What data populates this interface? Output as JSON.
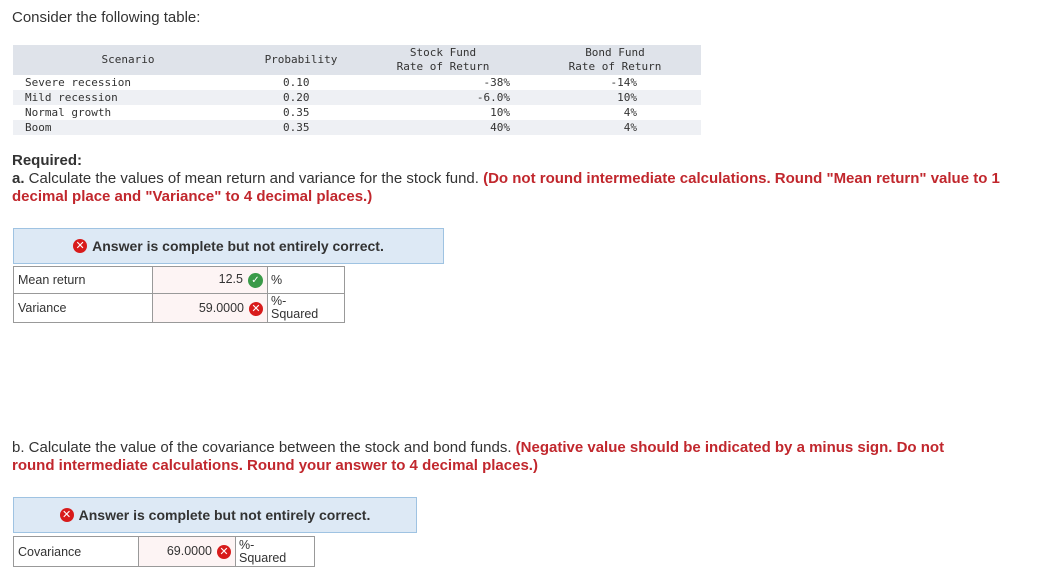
{
  "intro": "Consider the following table:",
  "table": {
    "headers": {
      "scenario": "Scenario",
      "probability": "Probability",
      "stock_line1": "Stock Fund",
      "stock_line2": "Rate of Return",
      "bond_line1": "Bond Fund",
      "bond_line2": "Rate of Return"
    },
    "rows": [
      {
        "scenario": "Severe recession",
        "probability": "0.10",
        "stock": "-38%",
        "bond": "-14%"
      },
      {
        "scenario": "Mild recession",
        "probability": "0.20",
        "stock": "-6.0%",
        "bond": "10%"
      },
      {
        "scenario": "Normal growth",
        "probability": "0.35",
        "stock": "10%",
        "bond": "4%"
      },
      {
        "scenario": "Boom",
        "probability": "0.35",
        "stock": "40%",
        "bond": "4%"
      }
    ]
  },
  "required": "Required:",
  "part_a": {
    "letter": "a.",
    "text": " Calculate the values of mean return and variance for the stock fund. ",
    "instruction": "(Do not round intermediate calculations. Round \"Mean return\" value to 1 decimal place and \"Variance\" to 4 decimal places.)",
    "banner": "Answer is complete but not entirely correct.",
    "answers": [
      {
        "label": "Mean return",
        "value": "12.5",
        "status": "correct",
        "unit_line1": "%",
        "unit_line2": ""
      },
      {
        "label": "Variance",
        "value": "59.0000",
        "status": "incorrect",
        "unit_line1": "%-",
        "unit_line2": "Squared"
      }
    ]
  },
  "part_b": {
    "text": "b. Calculate the value of the covariance between the stock and bond funds. ",
    "instruction": "(Negative value should be indicated by a minus sign. Do not round intermediate calculations. Round your answer to 4 decimal places.)",
    "banner": "Answer is complete but not entirely correct.",
    "answer": {
      "label": "Covariance",
      "value": "69.0000",
      "status": "incorrect",
      "unit_line1": "%-",
      "unit_line2": "Squared"
    }
  },
  "icons": {
    "correct": "check-circle-icon",
    "incorrect": "x-circle-icon"
  },
  "colors": {
    "instruction_red": "#c1272d",
    "banner_bg": "#dde9f5",
    "correct_green": "#3a9a48",
    "incorrect_red": "#d81b1b"
  }
}
